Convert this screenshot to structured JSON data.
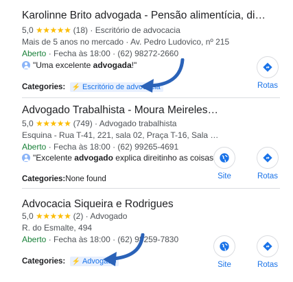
{
  "listings": [
    {
      "title": "Karolinne Brito advogada - Pensão alimentícia, di…",
      "rating": "5,0",
      "stars": "★★★★★",
      "reviews": "(18)",
      "type": "Escritório de advocacia",
      "line2": "Mais de 5 anos no mercado · Av. Pedro Ludovico, nº 215",
      "open": "Aberto",
      "hours": "· Fecha às 18:00 · (62) 98272-2660",
      "review_pre": "\"Uma excelente ",
      "review_bold": "advogada",
      "review_post": "!\"",
      "categories_label": "Categories:",
      "category_chip": "Escritório de advocacia",
      "actions": [
        {
          "label": "Rotas",
          "icon": "directions-icon"
        }
      ]
    },
    {
      "title": "Advogado Trabalhista - Moura Meireles…",
      "rating": "5,0",
      "stars": "★★★★★",
      "reviews": "(749)",
      "type": "Advogado trabalhista",
      "line2": "Esquina - Rua T-41, 221, sala 02, Praça T-16, Sala …",
      "open": "Aberto",
      "hours": "· Fecha às 18:00 · (62) 99265-4691",
      "review_pre": "\"Excelente ",
      "review_bold": "advogado",
      "review_post": " explica direitinho as coisas\"",
      "categories_label": "Categories:",
      "categories_value": "None found",
      "actions": [
        {
          "label": "Site",
          "icon": "globe-icon"
        },
        {
          "label": "Rotas",
          "icon": "directions-icon"
        }
      ]
    },
    {
      "title": "Advocacia Siqueira e Rodrigues",
      "rating": "5,0",
      "stars": "★★★★★",
      "reviews": "(2)",
      "type": "Advogado",
      "line2": "R. do Esmalte, 494",
      "open": "Aberto",
      "hours": "· Fecha às 18:00 · (62) 98259-7830",
      "categories_label": "Categories:",
      "category_chip": "Advogado",
      "actions": [
        {
          "label": "Site",
          "icon": "globe-icon"
        },
        {
          "label": "Rotas",
          "icon": "directions-icon"
        }
      ]
    }
  ],
  "colors": {
    "accent": "#1a73e8",
    "open": "#188038",
    "star": "#fbbc04",
    "arrow": "#2a62b8"
  }
}
